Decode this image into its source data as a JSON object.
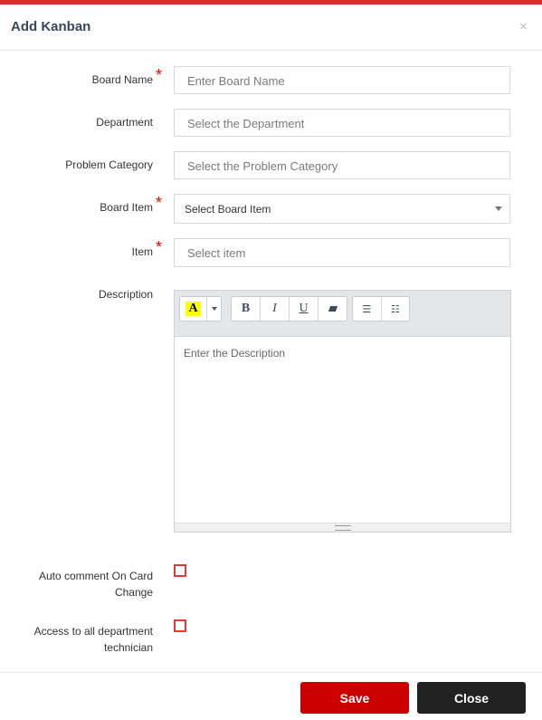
{
  "modal": {
    "title": "Add Kanban",
    "close_symbol": "×"
  },
  "fields": {
    "board_name": {
      "label": "Board Name",
      "placeholder": "Enter Board Name",
      "required": true
    },
    "department": {
      "label": "Department",
      "placeholder": "Select the Department"
    },
    "problem_category": {
      "label": "Problem Category",
      "placeholder": "Select the Problem Category"
    },
    "board_item": {
      "label": "Board Item",
      "selected": "Select Board Item",
      "required": true
    },
    "item": {
      "label": "Item",
      "placeholder": "Select item",
      "required": true
    },
    "description": {
      "label": "Description",
      "placeholder": "Enter the Description"
    }
  },
  "toolbar": {
    "color_glyph": "A",
    "bold": "B",
    "italic": "I",
    "underline": "U",
    "ul_glyph": "☰",
    "ol_glyph": "☷"
  },
  "checkboxes": {
    "auto_comment": {
      "label_line1": "Auto comment On Card",
      "label_line2": "Change",
      "checked": false
    },
    "access_all": {
      "label_line1": "Access to all department",
      "label_line2": "technician",
      "checked": false
    }
  },
  "buttons": {
    "save": "Save",
    "close": "Close"
  },
  "colors": {
    "accent": "#d32f2f",
    "save_bg": "#cc0000",
    "close_bg": "#222222",
    "required": "#ee0000"
  }
}
